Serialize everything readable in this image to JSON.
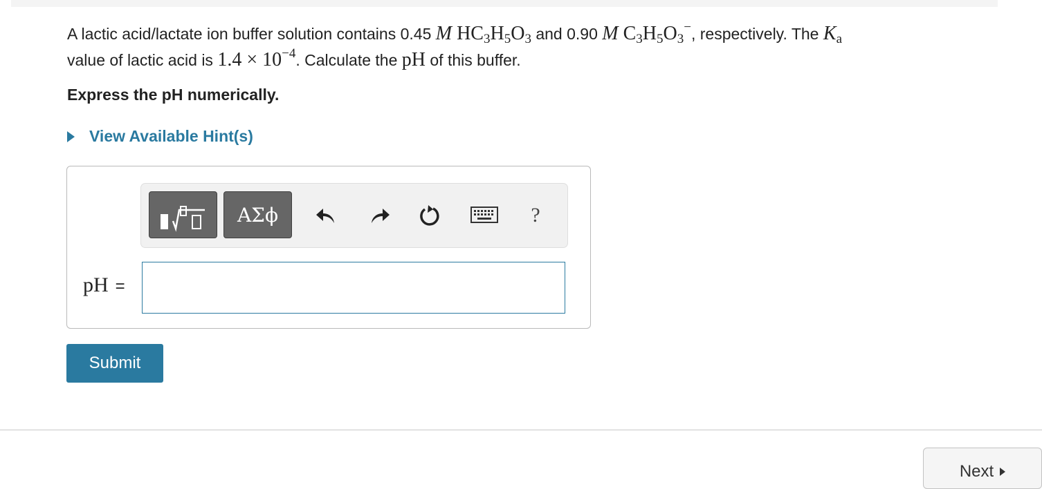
{
  "question": {
    "line1_intro": "A lactic acid/lactate ion buffer solution contains ",
    "acid_conc": "0.45",
    "and": " and ",
    "base_conc": "0.90",
    "respectively": ", respectively. The ",
    "value_of": "value of lactic acid is ",
    "calc": ". Calculate the ",
    "of_buffer": " of this buffer.",
    "ka_mantissa": "1.4",
    "ka_exponent": "−4",
    "ph_word": "pH"
  },
  "instruction": "Express the pH numerically.",
  "hint": {
    "label": "View Available Hint(s)"
  },
  "toolbar": {
    "greek_label": "ΑΣϕ",
    "help_label": "?",
    "icons": [
      "templates-icon",
      "greek-symbols",
      "undo-icon",
      "redo-icon",
      "reset-icon",
      "keyboard-icon",
      "help-icon"
    ]
  },
  "answer": {
    "label": "pH",
    "equals": "=",
    "value": "",
    "placeholder": ""
  },
  "submit": {
    "label": "Submit"
  },
  "next": {
    "label": "Next"
  },
  "colors": {
    "accent": "#2a7aa0",
    "toolbar_dark": "#666666",
    "toolbar_bg": "#f1f1f1"
  }
}
